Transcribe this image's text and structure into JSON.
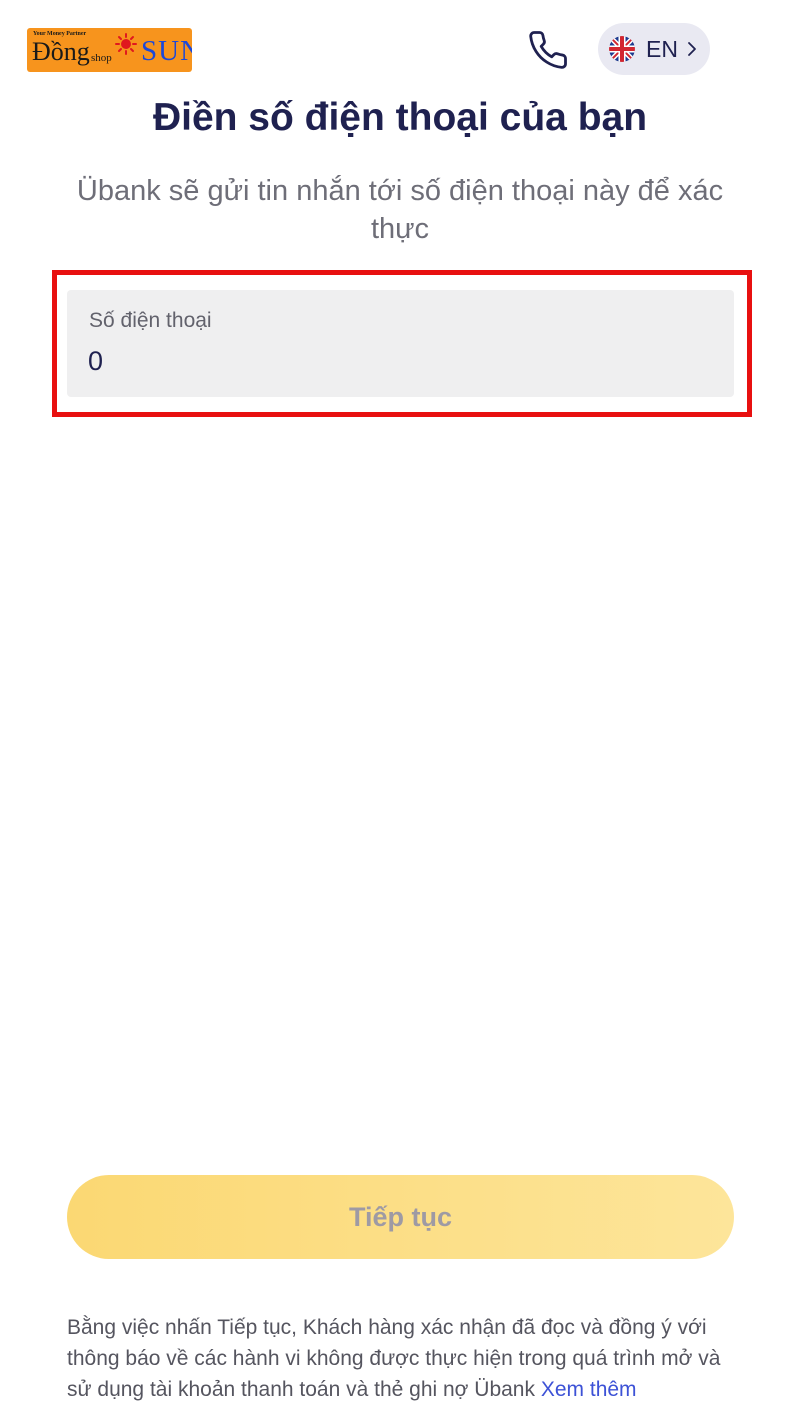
{
  "watermark": {
    "tagline": "Your Money Partner",
    "brand_main": "Đồng",
    "brand_small": "shop",
    "brand_sun": "SUN"
  },
  "header": {
    "phone_icon": "phone-icon",
    "language": {
      "flag_icon": "uk-flag-icon",
      "label": "EN",
      "chevron_icon": "chevron-right-icon"
    }
  },
  "page": {
    "title": "Điền số điện thoại của bạn",
    "subtitle": "Übank sẽ gửi tin nhắn tới số điện thoại này để xác thực"
  },
  "phone_field": {
    "label": "Số điện thoại",
    "value": "0"
  },
  "continue_button": {
    "label": "Tiếp tục"
  },
  "disclaimer": {
    "text": "Bằng việc nhấn Tiếp tục, Khách hàng xác nhận đã đọc và đồng ý với thông báo về các hành vi không được thực hiện trong quá trình mở và sử dụng tài khoản thanh toán và thẻ ghi nợ Übank",
    "link_label": "Xem thêm"
  },
  "colors": {
    "primary_text": "#1f2150",
    "subtitle_text": "#6e6e78",
    "field_background": "#efeff0",
    "highlight_border": "#e81010",
    "button_yellow": "#fbd873",
    "button_text_disabled": "#9e9aa4",
    "link": "#3d52d6",
    "watermark_orange": "#f7941d",
    "watermark_blue": "#1c48d9"
  }
}
